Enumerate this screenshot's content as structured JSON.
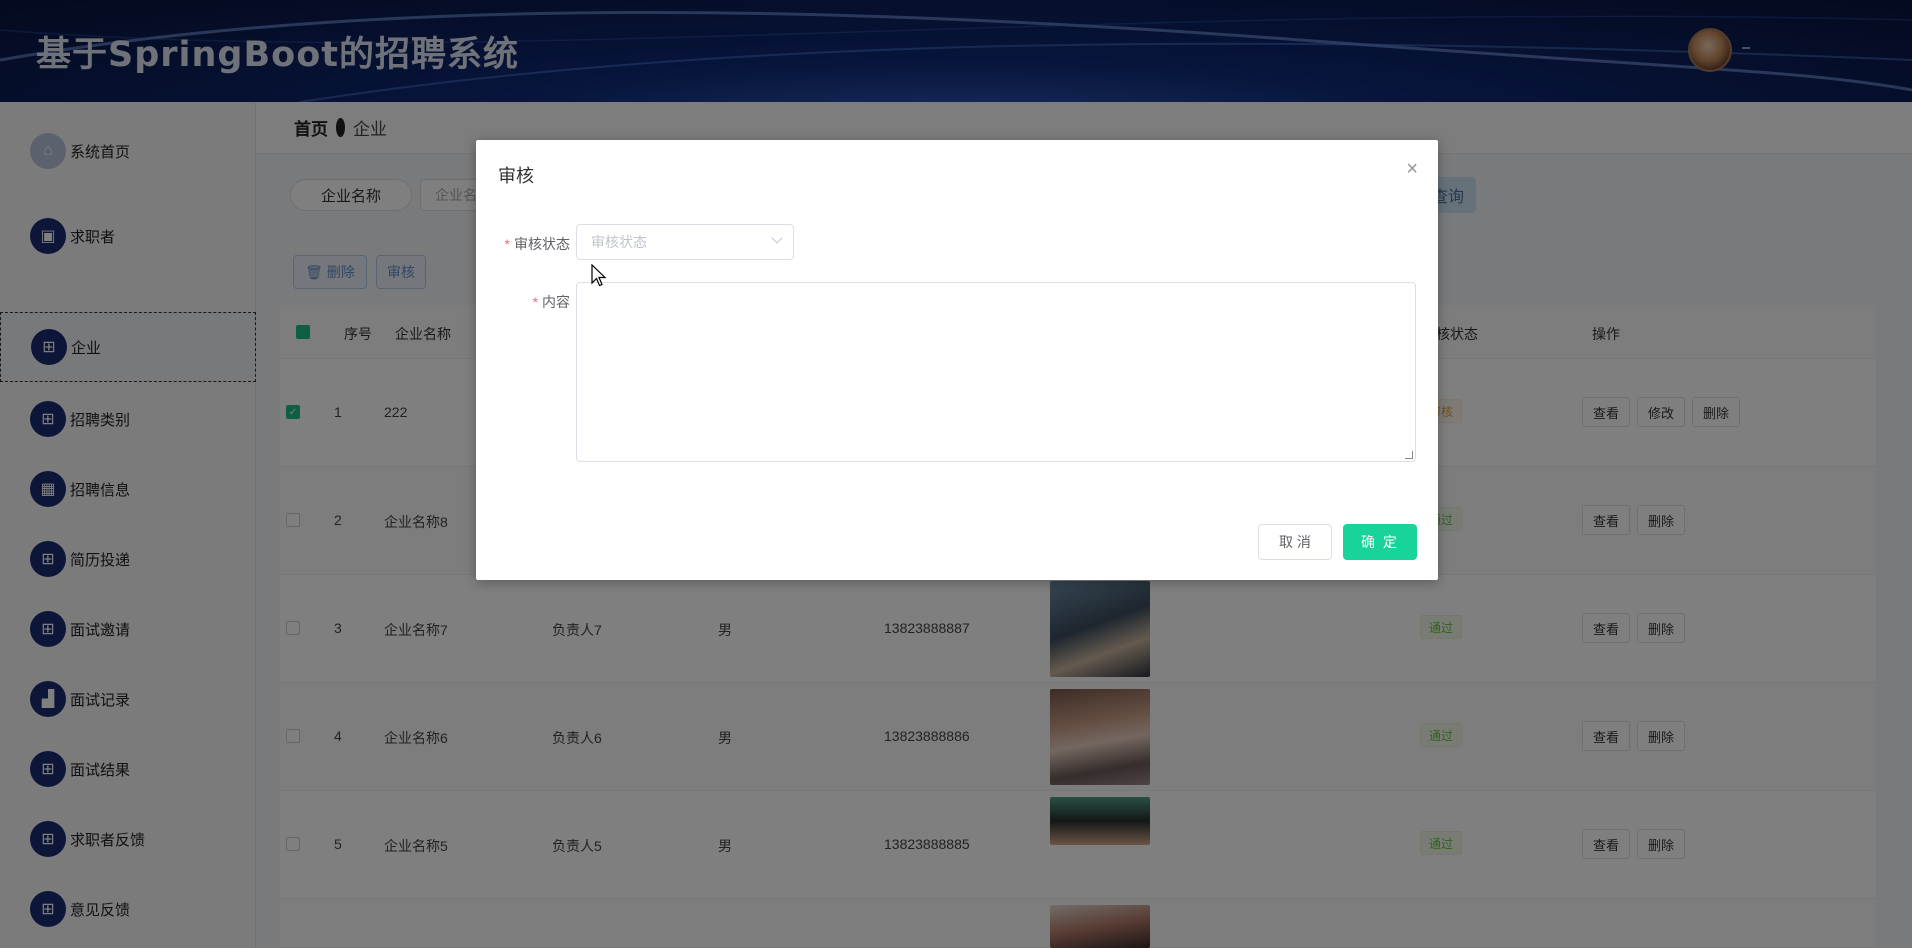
{
  "app": {
    "title": "基于SpringBoot的招聘系统"
  },
  "breadcrumb": {
    "home": "首页",
    "current": "企业"
  },
  "sidebar": {
    "items": [
      {
        "label": "系统首页",
        "icon": "home-icon"
      },
      {
        "label": "求职者",
        "icon": "briefcase-icon"
      },
      {
        "label": "企业",
        "icon": "grid-icon",
        "active": true
      },
      {
        "label": "招聘类别",
        "icon": "grid-icon"
      },
      {
        "label": "招聘信息",
        "icon": "table-icon"
      },
      {
        "label": "简历投递",
        "icon": "grid-icon"
      },
      {
        "label": "面试邀请",
        "icon": "grid-icon"
      },
      {
        "label": "面试记录",
        "icon": "chart-icon"
      },
      {
        "label": "面试结果",
        "icon": "grid-icon"
      },
      {
        "label": "求职者反馈",
        "icon": "grid-icon"
      },
      {
        "label": "意见反馈",
        "icon": "grid-icon"
      }
    ]
  },
  "search": {
    "label": "企业名称",
    "placeholder": "企业名",
    "query_label": "查询"
  },
  "toolbar": {
    "delete_label": "删除",
    "audit_label": "审核"
  },
  "table": {
    "headers": {
      "index": "序号",
      "company": "企业名称",
      "audit_status": "核状态",
      "actions": "操作"
    },
    "rows": [
      {
        "index": "1",
        "company": "222",
        "contact": "",
        "gender": "",
        "phone": "",
        "status": "审核",
        "status_type": "pending",
        "checked": true,
        "actions": [
          "查看",
          "修改",
          "删除"
        ]
      },
      {
        "index": "2",
        "company": "企业名称8",
        "contact": "",
        "gender": "",
        "phone": "",
        "status": "通过",
        "status_type": "pass",
        "checked": false,
        "actions": [
          "查看",
          "删除"
        ]
      },
      {
        "index": "3",
        "company": "企业名称7",
        "contact": "负责人7",
        "gender": "男",
        "phone": "13823888887",
        "status": "通过",
        "status_type": "pass",
        "checked": false,
        "actions": [
          "查看",
          "删除"
        ]
      },
      {
        "index": "4",
        "company": "企业名称6",
        "contact": "负责人6",
        "gender": "男",
        "phone": "13823888886",
        "status": "通过",
        "status_type": "pass",
        "checked": false,
        "actions": [
          "查看",
          "删除"
        ]
      },
      {
        "index": "5",
        "company": "企业名称5",
        "contact": "负责人5",
        "gender": "男",
        "phone": "13823888885",
        "status": "通过",
        "status_type": "pass",
        "checked": false,
        "actions": [
          "查看",
          "删除"
        ]
      }
    ]
  },
  "modal": {
    "title": "审核",
    "close_glyph": "×",
    "status_label": "审核状态",
    "status_placeholder": "审核状态",
    "content_label": "内容",
    "required_mark": "*",
    "cancel_label": "取 消",
    "confirm_label": "确 定"
  },
  "colors": {
    "header_bg": "#0b1d55",
    "menu_icon_bg": "#1b2a72",
    "confirm_bg": "#19d49a",
    "required": "#f56c6c"
  }
}
